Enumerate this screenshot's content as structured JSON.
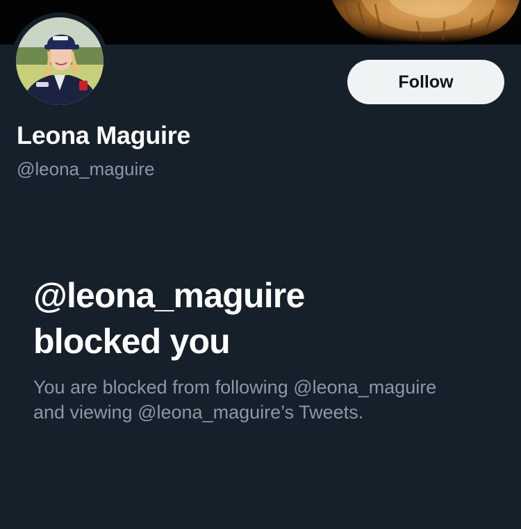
{
  "profile": {
    "display_name": "Leona Maguire",
    "handle": "@leona_maguire",
    "avatar_icon": "profile-photo",
    "banner_image": "lion-mane-photo"
  },
  "actions": {
    "follow_label": "Follow"
  },
  "blocked_notice": {
    "title_line1": "@leona_maguire",
    "title_line2": "blocked you",
    "desc_line1": "You are blocked from following @leona_maguire",
    "desc_line2": "and viewing @leona_maguire’s Tweets."
  },
  "colors": {
    "background": "#15202b",
    "banner": "#030303",
    "primary_text": "#ffffff",
    "secondary_text": "#8b98a5",
    "follow_button_bg": "#eff3f4",
    "follow_button_text": "#0f1419"
  }
}
